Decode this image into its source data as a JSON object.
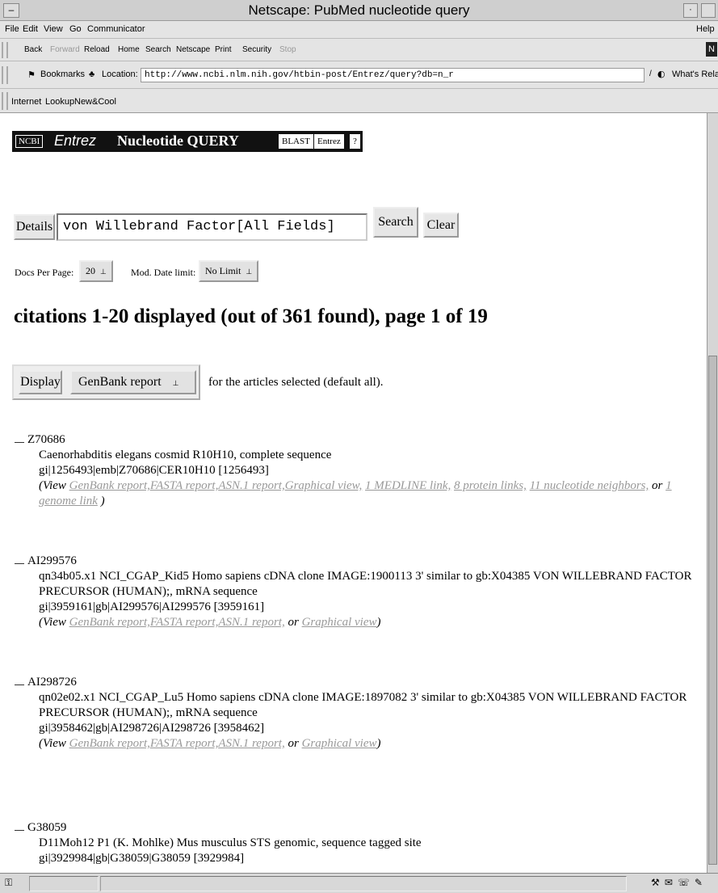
{
  "window": {
    "title": "Netscape: PubMed nucleotide query"
  },
  "menu": [
    "File",
    "Edit",
    "View",
    "Go",
    "Communicator",
    "Help"
  ],
  "toolbar": [
    "Back",
    "Forward",
    "Reload",
    "Home",
    "Search",
    "Netscape",
    "Print",
    "Security",
    "Stop"
  ],
  "location": {
    "bookmarks": "Bookmarks",
    "label": "Location:",
    "url": "http://www.ncbi.nlm.nih.gov/htbin-post/Entrez/query?db=n_r",
    "related": "What's Related"
  },
  "personal_toolbar": [
    "Internet",
    "Lookup",
    "New&Cool"
  ],
  "banner": {
    "ncbi": "NCBI",
    "entrez": "Entrez",
    "title": "Nucleotide QUERY",
    "blast": "BLAST",
    "entrez_btn": "Entrez",
    "help": "?"
  },
  "query": {
    "details": "Details",
    "value": "von Willebrand Factor[All Fields]",
    "search": "Search",
    "clear": "Clear"
  },
  "options": {
    "docs_label": "Docs Per Page:",
    "docs_value": "20",
    "mod_label": "Mod. Date limit:",
    "mod_value": "No Limit"
  },
  "headline": "citations 1-20 displayed (out of 361 found), page 1 of 19",
  "display": {
    "button": "Display",
    "format": "GenBank report",
    "note": "for the articles selected (default all)."
  },
  "records": [
    {
      "accession": "Z70686",
      "description": "Caenorhabditis elegans cosmid R10H10, complete sequence",
      "ids": "gi|1256493|emb|Z70686|CER10H10 [1256493]",
      "view": "(View",
      "links": [
        "GenBank report,",
        "FASTA report,",
        "ASN.1 report,",
        "Graphical view,",
        "1 MEDLINE link,",
        "8 protein links,",
        "11 nucleotide neighbors,",
        "or",
        "1 genome link",
        ")"
      ]
    },
    {
      "accession": "AI299576",
      "description": "qn34b05.x1 NCI_CGAP_Kid5 Homo sapiens cDNA clone IMAGE:1900113 3' similar to gb:X04385 VON WILLEBRAND FACTOR PRECURSOR (HUMAN);, mRNA sequence",
      "ids": "gi|3959161|gb|AI299576|AI299576 [3959161]",
      "view": "(View",
      "links": [
        "GenBank report,",
        "FASTA report,",
        "ASN.1 report,",
        "or",
        "Graphical view",
        ")"
      ]
    },
    {
      "accession": "AI298726",
      "description": "qn02e02.x1 NCI_CGAP_Lu5 Homo sapiens cDNA clone IMAGE:1897082 3' similar to gb:X04385 VON WILLEBRAND FACTOR PRECURSOR (HUMAN);, mRNA sequence",
      "ids": "gi|3958462|gb|AI298726|AI298726 [3958462]",
      "view": "(View",
      "links": [
        "GenBank report,",
        "FASTA report,",
        "ASN.1 report,",
        "or",
        "Graphical view",
        ")"
      ]
    },
    {
      "accession": "G38059",
      "description": "D11Moh12 P1 (K. Mohlke) Mus musculus STS genomic, sequence tagged site",
      "ids": "gi|3929984|gb|G38059|G38059 [3929984]"
    }
  ]
}
